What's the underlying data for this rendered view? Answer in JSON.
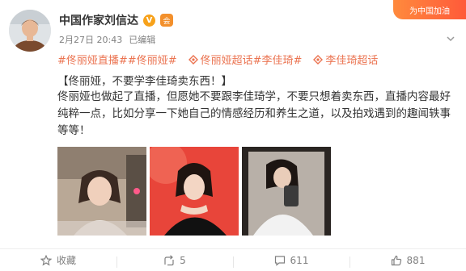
{
  "post": {
    "username": "中国作家刘信达",
    "verified_badge": "V",
    "member_badge": "会",
    "timestamp": "2月27日 20:43",
    "edited_label": "已编辑",
    "promo_label": "为中国加油",
    "tags": [
      "#佟丽娅直播#",
      "#佟丽娅#",
      "佟丽娅超话",
      "#李佳琦#",
      "李佳琦超话"
    ],
    "title": "【佟丽娅，不要学李佳琦卖东西！】",
    "body": "佟丽娅也做起了直播，但愿她不要跟李佳琦学，不要只想着卖东西，直播内容最好纯粹一点，比如分享一下她自己的情感经历和养生之道，以及拍戏遇到的趣闻轶事等等！",
    "images": [
      "photo-livestream",
      "photo-red-portrait",
      "photo-mirror-selfie"
    ]
  },
  "actions": {
    "favorite_label": "收藏",
    "repost_count": "5",
    "comment_count": "611",
    "like_count": "881"
  },
  "icons": {
    "repost": "repost-icon",
    "comment": "comment-icon",
    "like": "like-icon",
    "favorite": "star-icon",
    "super_topic": "super-topic-icon"
  },
  "colors": {
    "tag_orange": "#eb7350",
    "verified_gold": "#f7a21b",
    "meta_gray": "#808080"
  }
}
